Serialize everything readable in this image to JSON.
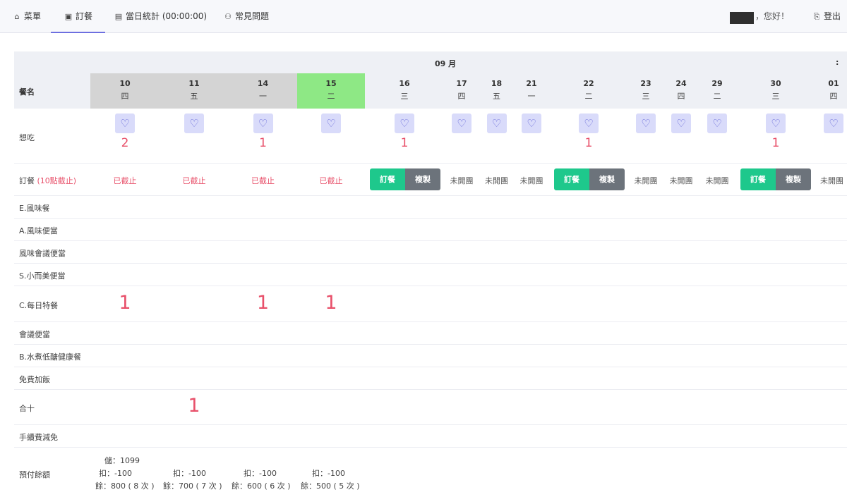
{
  "nav": {
    "menu": "菜單",
    "order": "訂餐",
    "stats": "當日統計 (00:00:00)",
    "faq": "常見問題",
    "greeting": "，您好！",
    "logout": "登出"
  },
  "icons": {
    "menu": "home-icon",
    "order": "calendar-icon",
    "stats": "table-icon",
    "faq": "users-icon",
    "logout": "logout-icon",
    "heart": "heart-icon"
  },
  "colors": {
    "accent": "#6d6fe0",
    "past_column": "#d4d4d4",
    "today_column": "#8ee885",
    "order_button": "#1ec88c",
    "copy_button": "#6c737b",
    "warning_text": "#e8506a"
  },
  "grid": {
    "month": "09 月",
    "right_glyph": ":",
    "col_header": "餐名",
    "dates": [
      {
        "day": "10",
        "weekday": "四",
        "state": "past"
      },
      {
        "day": "11",
        "weekday": "五",
        "state": "past"
      },
      {
        "day": "14",
        "weekday": "一",
        "state": "past"
      },
      {
        "day": "15",
        "weekday": "二",
        "state": "today"
      },
      {
        "day": "16",
        "weekday": "三",
        "state": "open"
      },
      {
        "day": "17",
        "weekday": "四",
        "state": "unopened"
      },
      {
        "day": "18",
        "weekday": "五",
        "state": "unopened"
      },
      {
        "day": "21",
        "weekday": "一",
        "state": "unopened"
      },
      {
        "day": "22",
        "weekday": "二",
        "state": "open"
      },
      {
        "day": "23",
        "weekday": "三",
        "state": "unopened"
      },
      {
        "day": "24",
        "weekday": "四",
        "state": "unopened"
      },
      {
        "day": "29",
        "weekday": "二",
        "state": "unopened"
      },
      {
        "day": "30",
        "weekday": "三",
        "state": "open"
      },
      {
        "day": "01",
        "weekday": "四",
        "state": "unopened"
      }
    ],
    "want_label": "想吃",
    "want_counts": [
      "2",
      "",
      "1",
      "",
      "1",
      "",
      "",
      "",
      "1",
      "",
      "",
      "",
      "1",
      ""
    ],
    "order_label": "訂餐 ",
    "order_deadline": "(10點截止)",
    "closed_text": "已截止",
    "unopened_text": "未開團",
    "unopened_partial": "未開團",
    "order_button": "訂餐",
    "copy_button": "複製",
    "meals": [
      {
        "name": "E.風味餐"
      },
      {
        "name": "A.風味便當"
      },
      {
        "name": "風味會議便當"
      },
      {
        "name": "S.小而美便當"
      },
      {
        "name": "C.每日特餐",
        "counts": {
          "0": "1",
          "2": "1",
          "3": "1"
        }
      },
      {
        "name": "會議便當"
      },
      {
        "name": "B.水煮低醣健康餐"
      },
      {
        "name": "免費加飯"
      },
      {
        "name": "合十",
        "counts": {
          "1": "1"
        }
      },
      {
        "name": "手續費減免"
      }
    ],
    "prepay": {
      "label": "預付餘額",
      "deposit": "儲：1099",
      "deductions": [
        "扣：-100",
        "扣：-100",
        "扣：-100",
        "扣：-100"
      ],
      "balances": [
        "餘：800 ( 8 次 )",
        "餘：700 ( 7 次 )",
        "餘：600 ( 6 次 )",
        "餘：500 ( 5 次 )"
      ]
    }
  }
}
